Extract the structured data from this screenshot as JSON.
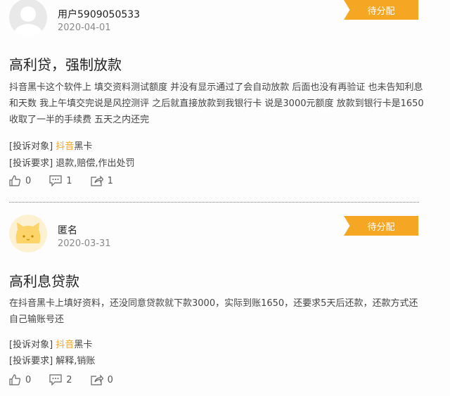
{
  "posts": [
    {
      "username": "用户5909050533",
      "date": "2020-04-01",
      "status": "待分配",
      "title": "高利贷，强制放款",
      "content": "抖音黑卡这个软件上  填交资料测试额度  并没有显示通过了会自动放款  后面也没有再验证  也未告知利息和天数  我上午填交完说是风控测评  之后就直接放款到我银行卡  说是3000元额度  放款到银行卡是1650  收取了一半的手续费  五天之内还完",
      "target_label": "[投诉对象]",
      "target_highlight": "抖音",
      "target_rest": "黑卡",
      "request_label": "[投诉要求]",
      "request_value": "退款,赔偿,作出处罚",
      "likes": "0",
      "comments": "1",
      "shares": "1"
    },
    {
      "username": "匿名",
      "date": "2020-03-31",
      "status": "待分配",
      "title": "高利息贷款",
      "content": "在抖音黑卡上填好资料，还没同意贷款就下款3000，实际到账1650，还要求5天后还款，还款方式还自己输账号还",
      "target_label": "[投诉对象]",
      "target_highlight": "抖音",
      "target_rest": "黑卡",
      "request_label": "[投诉要求]",
      "request_value": "解释,销账",
      "likes": "0",
      "comments": "2",
      "shares": "0"
    }
  ]
}
